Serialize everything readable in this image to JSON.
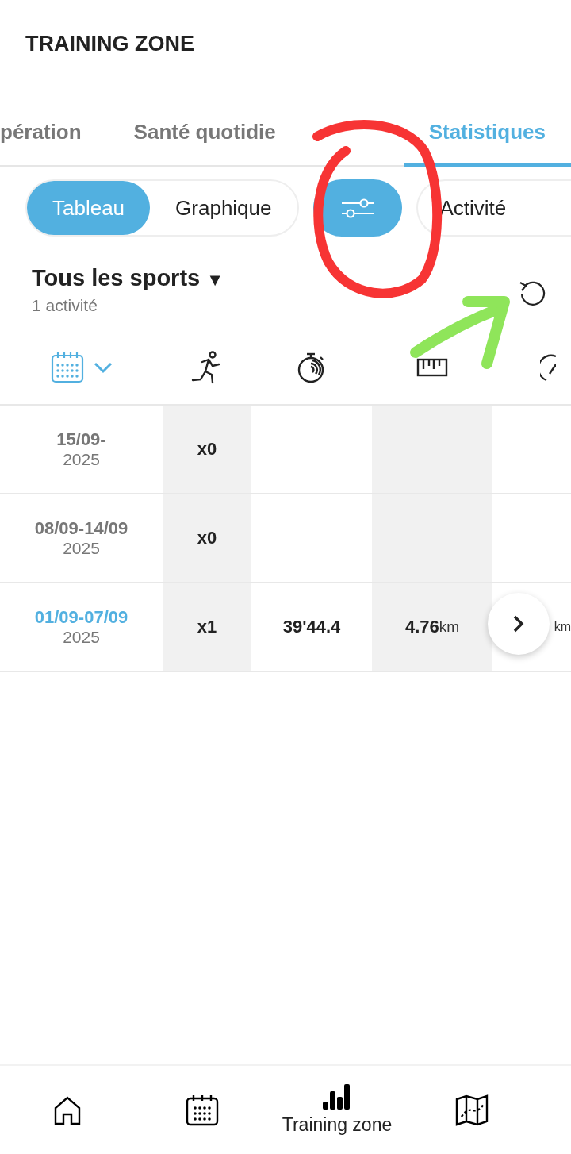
{
  "header": {
    "title": "TRAINING ZONE"
  },
  "tabs": [
    {
      "label": "pération",
      "selected": false
    },
    {
      "label": "Santé quotidie",
      "selected": false
    },
    {
      "label": "Statistiques",
      "selected": true
    }
  ],
  "view_toggle": [
    {
      "label": "Tableau",
      "selected": true
    },
    {
      "label": "Graphique",
      "selected": false
    }
  ],
  "filter_button": {
    "active": true
  },
  "activity_chip": {
    "label": "Activité"
  },
  "sport_filter": {
    "title": "Tous les sports",
    "caret": "▼",
    "count": "1 activité"
  },
  "rows": [
    {
      "period": "15/09-",
      "year": "2025",
      "selected": false,
      "count": "x0"
    },
    {
      "period": "08/09-14/09",
      "year": "2025",
      "selected": false,
      "count": "x0"
    },
    {
      "period": "01/09-07/09",
      "year": "2025",
      "selected": true,
      "count": "x1",
      "time": "39'44.4",
      "distance": "4.76",
      "distance_unit": "km",
      "column_5": "km"
    }
  ],
  "nav": [
    {
      "kind": "home",
      "selected": false
    },
    {
      "kind": "calendar",
      "selected": false
    },
    {
      "kind": "stats",
      "label": "Training zone",
      "selected": true
    },
    {
      "kind": "map",
      "selected": false
    }
  ]
}
